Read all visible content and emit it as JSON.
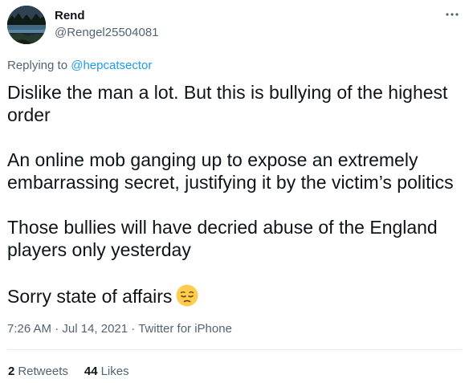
{
  "author": {
    "display_name": "Rend",
    "handle": "@Rengel25504081",
    "avatar_icon": "lake-landscape-avatar"
  },
  "reply": {
    "prefix": "Replying to",
    "mention": "@hepcatsector"
  },
  "tweet": {
    "paragraphs": [
      "Dislike the man a lot. But this is bullying of the highest order",
      "An online mob ganging up to expose an extremely embarrassing secret, justifying it by the victim’s politics",
      "Those bullies will have decried abuse of the England players only yesterday",
      "Sorry state of affairs"
    ],
    "emoji": "pensive-face-emoji"
  },
  "meta": {
    "time": "7:26 AM",
    "separator": "·",
    "date": "Jul 14, 2021",
    "source": "Twitter for iPhone"
  },
  "stats": {
    "retweets_count": "2",
    "retweets_label": "Retweets",
    "likes_count": "44",
    "likes_label": "Likes"
  },
  "icons": {
    "more": "more-options-icon"
  },
  "colors": {
    "link": "#1d9bf0",
    "secondary_text": "#536471",
    "primary_text": "#0f1419",
    "divider": "#e7ecf0"
  }
}
